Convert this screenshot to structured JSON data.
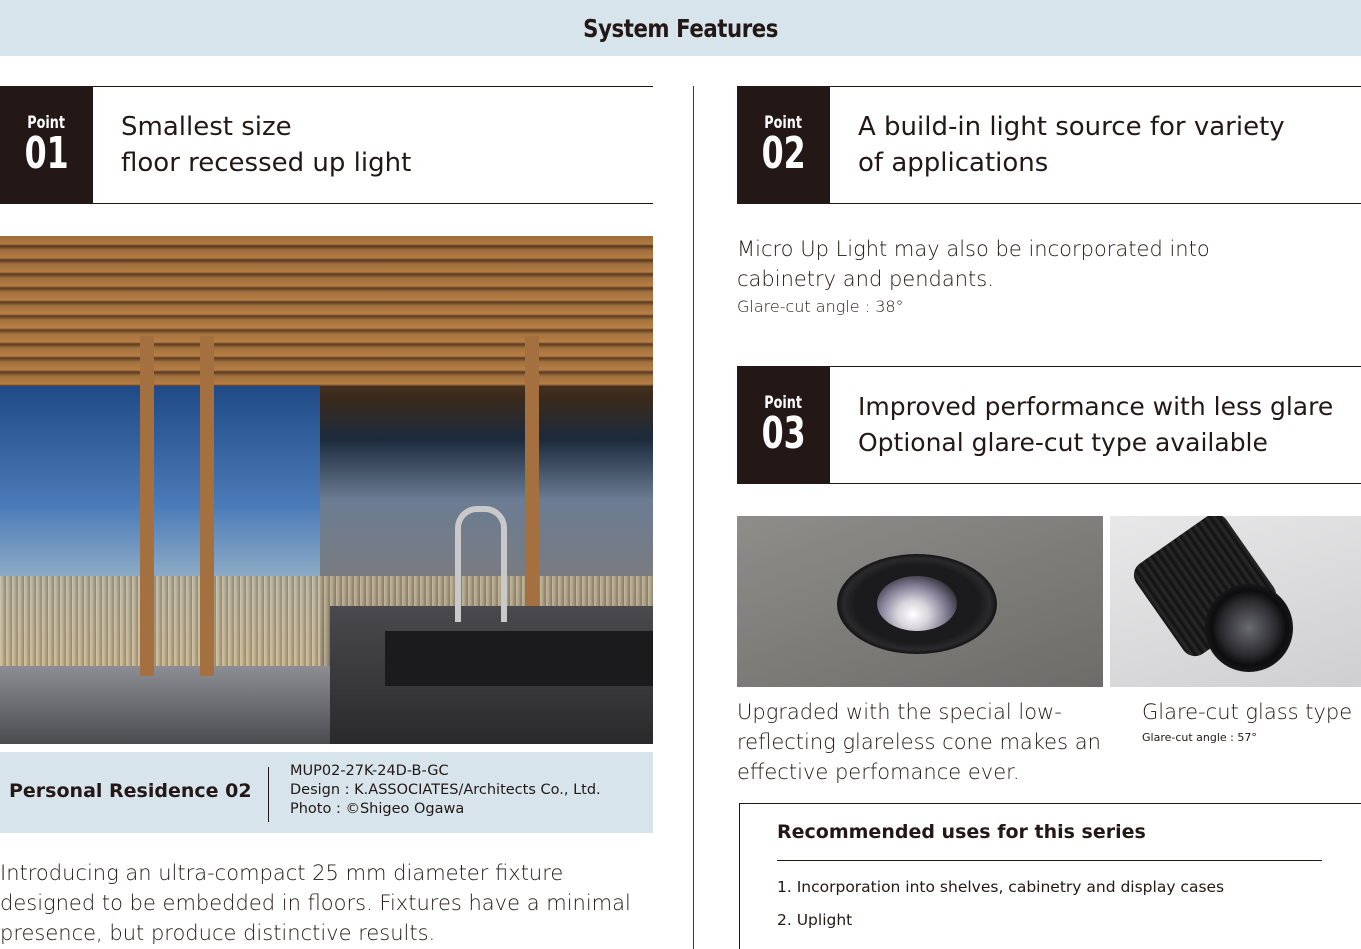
{
  "header": {
    "title": "System Features"
  },
  "points": [
    {
      "word": "Point",
      "num": "01",
      "title": "Smallest size\nfloor recessed up light"
    },
    {
      "word": "Point",
      "num": "02",
      "title": "A build-in light source for variety\nof applications"
    },
    {
      "word": "Point",
      "num": "03",
      "title": "Improved performance with less glare\nOptional glare-cut type available"
    }
  ],
  "caption": {
    "name": "Personal Residence 02",
    "model": "MUP02-27K-24D-B-GC",
    "design": "Design : K.ASSOCIATES/Architects Co., Ltd.",
    "photo": "Photo : ©Shigeo Ogawa"
  },
  "point01_body": "Introducing an ultra-compact 25 mm diameter fixture designed to be embedded in floors. Fixtures have a minimal presence, but produce distinctive results.",
  "point02_body": {
    "line1": "Micro Up Light may also be incorporated into",
    "line2": "cabinetry and pendants.",
    "angle": "Glare-cut angle : 38°"
  },
  "point03_images": {
    "left_caption": "Upgraded with the special low-reflecting glareless cone makes an effective perfomance ever.",
    "right_caption": "Glare-cut glass type",
    "right_sub": "Glare-cut angle : 57°"
  },
  "recommended": {
    "title": "Recommended uses for this series",
    "items": [
      "1.  Incorporation into shelves, cabinetry and display cases",
      "2. Uplight"
    ]
  }
}
